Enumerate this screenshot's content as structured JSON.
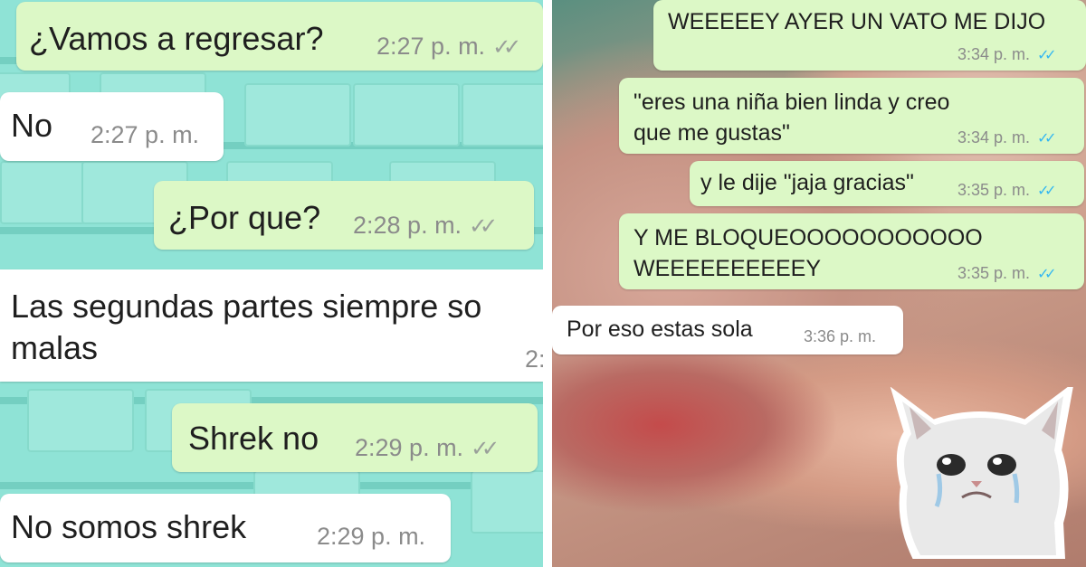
{
  "left_chat": {
    "messages": [
      {
        "direction": "outgoing",
        "text": "¿Vamos a regresar?",
        "time": "2:27 p. m.",
        "status": "read-grey"
      },
      {
        "direction": "incoming",
        "text": "No",
        "time": "2:27 p. m."
      },
      {
        "direction": "outgoing",
        "text": "¿Por que?",
        "time": "2:28 p. m.",
        "status": "read-grey"
      },
      {
        "direction": "incoming",
        "text": "Las segundas partes siempre so\nmalas",
        "time": "2:"
      },
      {
        "direction": "outgoing",
        "text": "Shrek no",
        "time": "2:29 p. m.",
        "status": "read-grey"
      },
      {
        "direction": "incoming",
        "text": "No somos shrek",
        "time": "2:29 p. m."
      }
    ]
  },
  "right_chat": {
    "messages": [
      {
        "direction": "outgoing",
        "text": "WEEEEEY AYER UN VATO ME DIJO",
        "time": "3:34 p. m.",
        "status": "read-blue"
      },
      {
        "direction": "outgoing",
        "text": "\"eres una niña bien linda y creo\nque me gustas\"",
        "time": "3:34 p. m.",
        "status": "read-blue"
      },
      {
        "direction": "outgoing",
        "text": "y le dije \"jaja gracias\"",
        "time": "3:35 p. m.",
        "status": "read-blue"
      },
      {
        "direction": "outgoing",
        "text": "Y  ME BLOQUEOOOOOOOOOOO\nWEEEEEEEEEEY",
        "time": "3:35 p. m.",
        "status": "read-blue"
      },
      {
        "direction": "incoming",
        "text": "Por eso estas sola",
        "time": "3:36 p. m."
      }
    ],
    "sticker": {
      "name": "crying-cat-sticker"
    }
  },
  "icons": {
    "tick_glyph": "✓✓"
  },
  "colors": {
    "outgoing_bubble": "#dcf8c6",
    "incoming_bubble": "#ffffff",
    "read_blue": "#34b7f1",
    "tick_grey": "#9aa09a",
    "wall": "#8fe3d6"
  }
}
